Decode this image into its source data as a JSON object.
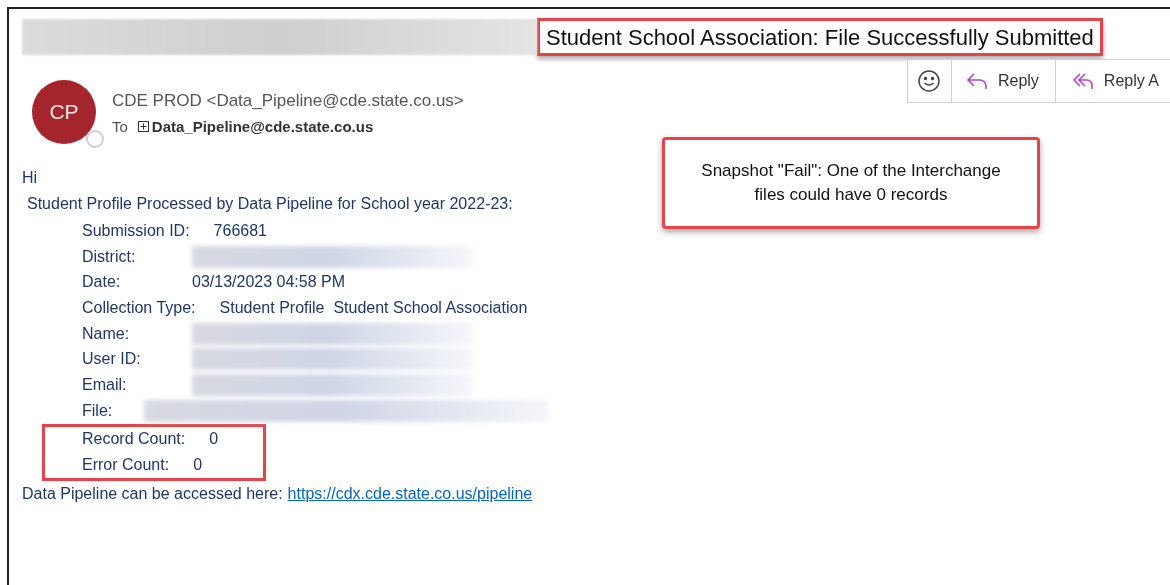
{
  "subject": "Student School Association: File Successfully Submitted",
  "toolbar": [
    {
      "kind": "emoji"
    },
    {
      "kind": "reply",
      "label": "Reply"
    },
    {
      "kind": "reply_all",
      "label": "Reply A"
    }
  ],
  "sender": {
    "initials": "CP",
    "from": "CDE PROD <Data_Pipeline@cde.state.co.us>",
    "to_label": "To",
    "to": "Data_Pipeline@cde.state.co.us"
  },
  "callout": "Snapshot \"Fail\": One of the Interchange files could have 0 records",
  "greeting": "Hi",
  "intro": "Student Profile Processed by Data Pipeline for School year 2022-23:",
  "fields": [
    {
      "label": "Submission ID:",
      "value": "766681",
      "redacted": false,
      "highlighted": false
    },
    {
      "label": "District:",
      "redacted": true,
      "highlighted": false
    },
    {
      "label": "Date:",
      "value": "03/13/2023 04:58 PM",
      "redacted": false,
      "highlighted": false
    },
    {
      "label": "Collection Type:",
      "value": "Student Profile  Student School Association",
      "redacted": false,
      "highlighted": false
    },
    {
      "label": "Name:",
      "redacted": true,
      "highlighted": false
    },
    {
      "label": "User ID:",
      "redacted": true,
      "highlighted": false
    },
    {
      "label": "Email:",
      "redacted": true,
      "highlighted": false
    },
    {
      "label": "File:",
      "redacted": true,
      "highlighted": false
    },
    {
      "label": "Record Count:",
      "value": "0",
      "redacted": false,
      "highlighted": true
    },
    {
      "label": "Error Count:",
      "value": "0",
      "redacted": false,
      "highlighted": true
    }
  ],
  "footer": {
    "text": "Data Pipeline can be accessed here:",
    "link": "https://cdx.cde.state.co.us/pipeline"
  }
}
